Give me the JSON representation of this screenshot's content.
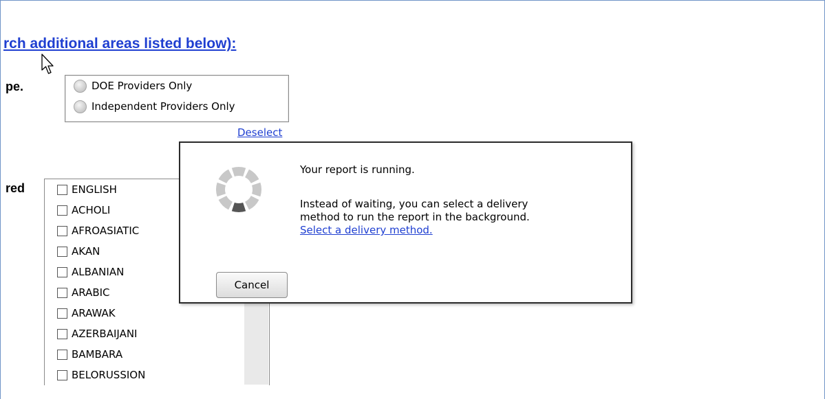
{
  "page": {
    "heading_link": "rch additional areas listed below):",
    "provider_type_label": "pe.",
    "languages_label": "red"
  },
  "provider_options": [
    {
      "label": "DOE Providers Only",
      "selected": false
    },
    {
      "label": "Independent Providers Only",
      "selected": false
    }
  ],
  "deselect_label": "Deselect",
  "languages": [
    "ENGLISH",
    "ACHOLI",
    "AFROASIATIC",
    "AKAN",
    "ALBANIAN",
    "ARABIC",
    "ARAWAK",
    "AZERBAIJANI",
    "BAMBARA",
    "BELORUSSION"
  ],
  "dialog": {
    "status": "Your report is running.",
    "info_line1": "Instead of waiting, you can select a delivery",
    "info_line2": "method to run the report in the background.",
    "delivery_link": "Select a delivery method.",
    "cancel_label": "Cancel"
  },
  "colors": {
    "link": "#1f3fd1",
    "frame_border": "#6f93c7",
    "spinner_light": "#c8c8c8",
    "spinner_dark": "#555555"
  }
}
